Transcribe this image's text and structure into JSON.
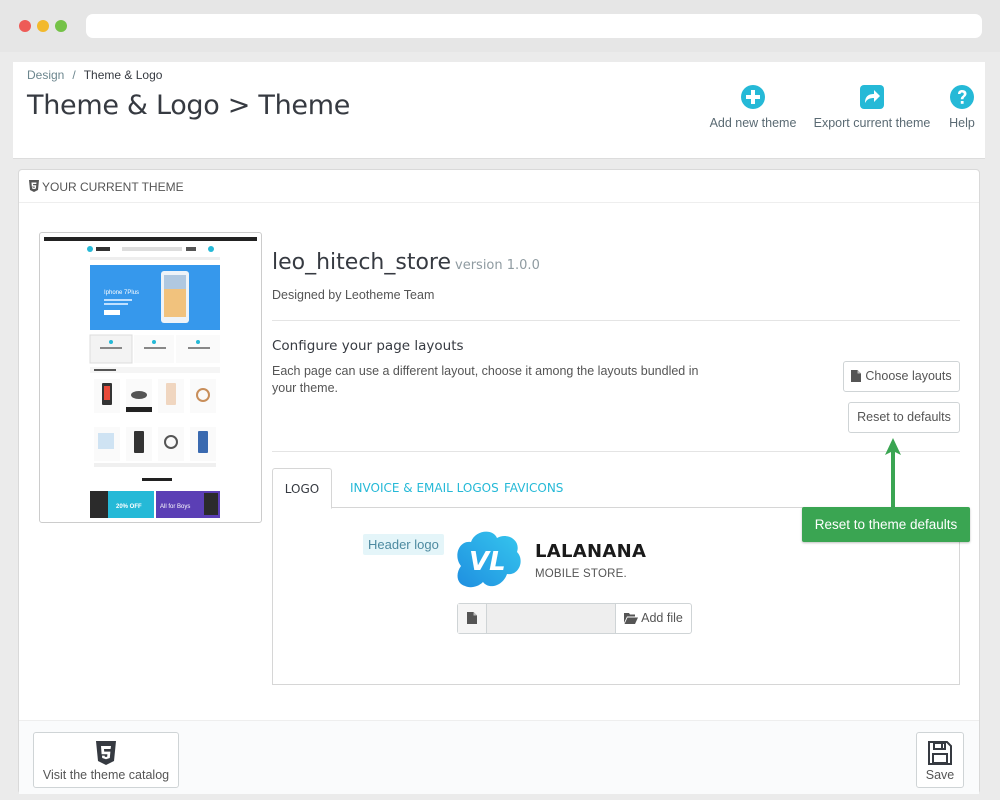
{
  "breadcrumb": {
    "parent": "Design",
    "separator": "/",
    "current": "Theme & Logo"
  },
  "page_title": "Theme & Logo > Theme",
  "toolbar": {
    "add_new_theme": "Add new theme",
    "export_current_theme": "Export current theme",
    "help": "Help"
  },
  "panel": {
    "heading": "YOUR CURRENT THEME"
  },
  "theme": {
    "name": "leo_hitech_store",
    "version": "version 1.0.0",
    "designed_by": "Designed by Leotheme Team"
  },
  "layouts": {
    "title": "Configure your page layouts",
    "description": "Each page can use a different layout, choose it among the layouts bundled in your theme.",
    "choose_button": "Choose layouts",
    "reset_button": "Reset to defaults"
  },
  "tabs": [
    {
      "label": "LOGO",
      "active": true
    },
    {
      "label": "INVOICE & EMAIL LOGOS",
      "active": false
    },
    {
      "label": "FAVICONS",
      "active": false
    }
  ],
  "logo_tab": {
    "header_logo_label": "Header logo",
    "logo_name": "LALANANA",
    "logo_subtitle": "MOBILE STORE.",
    "logo_monogram": "VL",
    "file_input_value": "",
    "add_file_button": "Add file"
  },
  "footer": {
    "catalog_button": "Visit the theme catalog",
    "save_button": "Save"
  },
  "annotation": {
    "text": "Reset to theme defaults"
  },
  "preview": {
    "banner_title": "Iphone 7Plus",
    "promo_left": "20% OFF",
    "promo_right": "All for Boys"
  },
  "colors": {
    "accent": "#25b9d7",
    "annotation_green": "#3aa552",
    "title_text": "#363a41"
  },
  "icons": {
    "add": "plus-circle-icon",
    "export": "share-icon",
    "help": "question-circle-icon",
    "html5": "html5-icon",
    "file": "file-icon",
    "folder": "folder-open-icon",
    "save": "floppy-disk-icon"
  }
}
